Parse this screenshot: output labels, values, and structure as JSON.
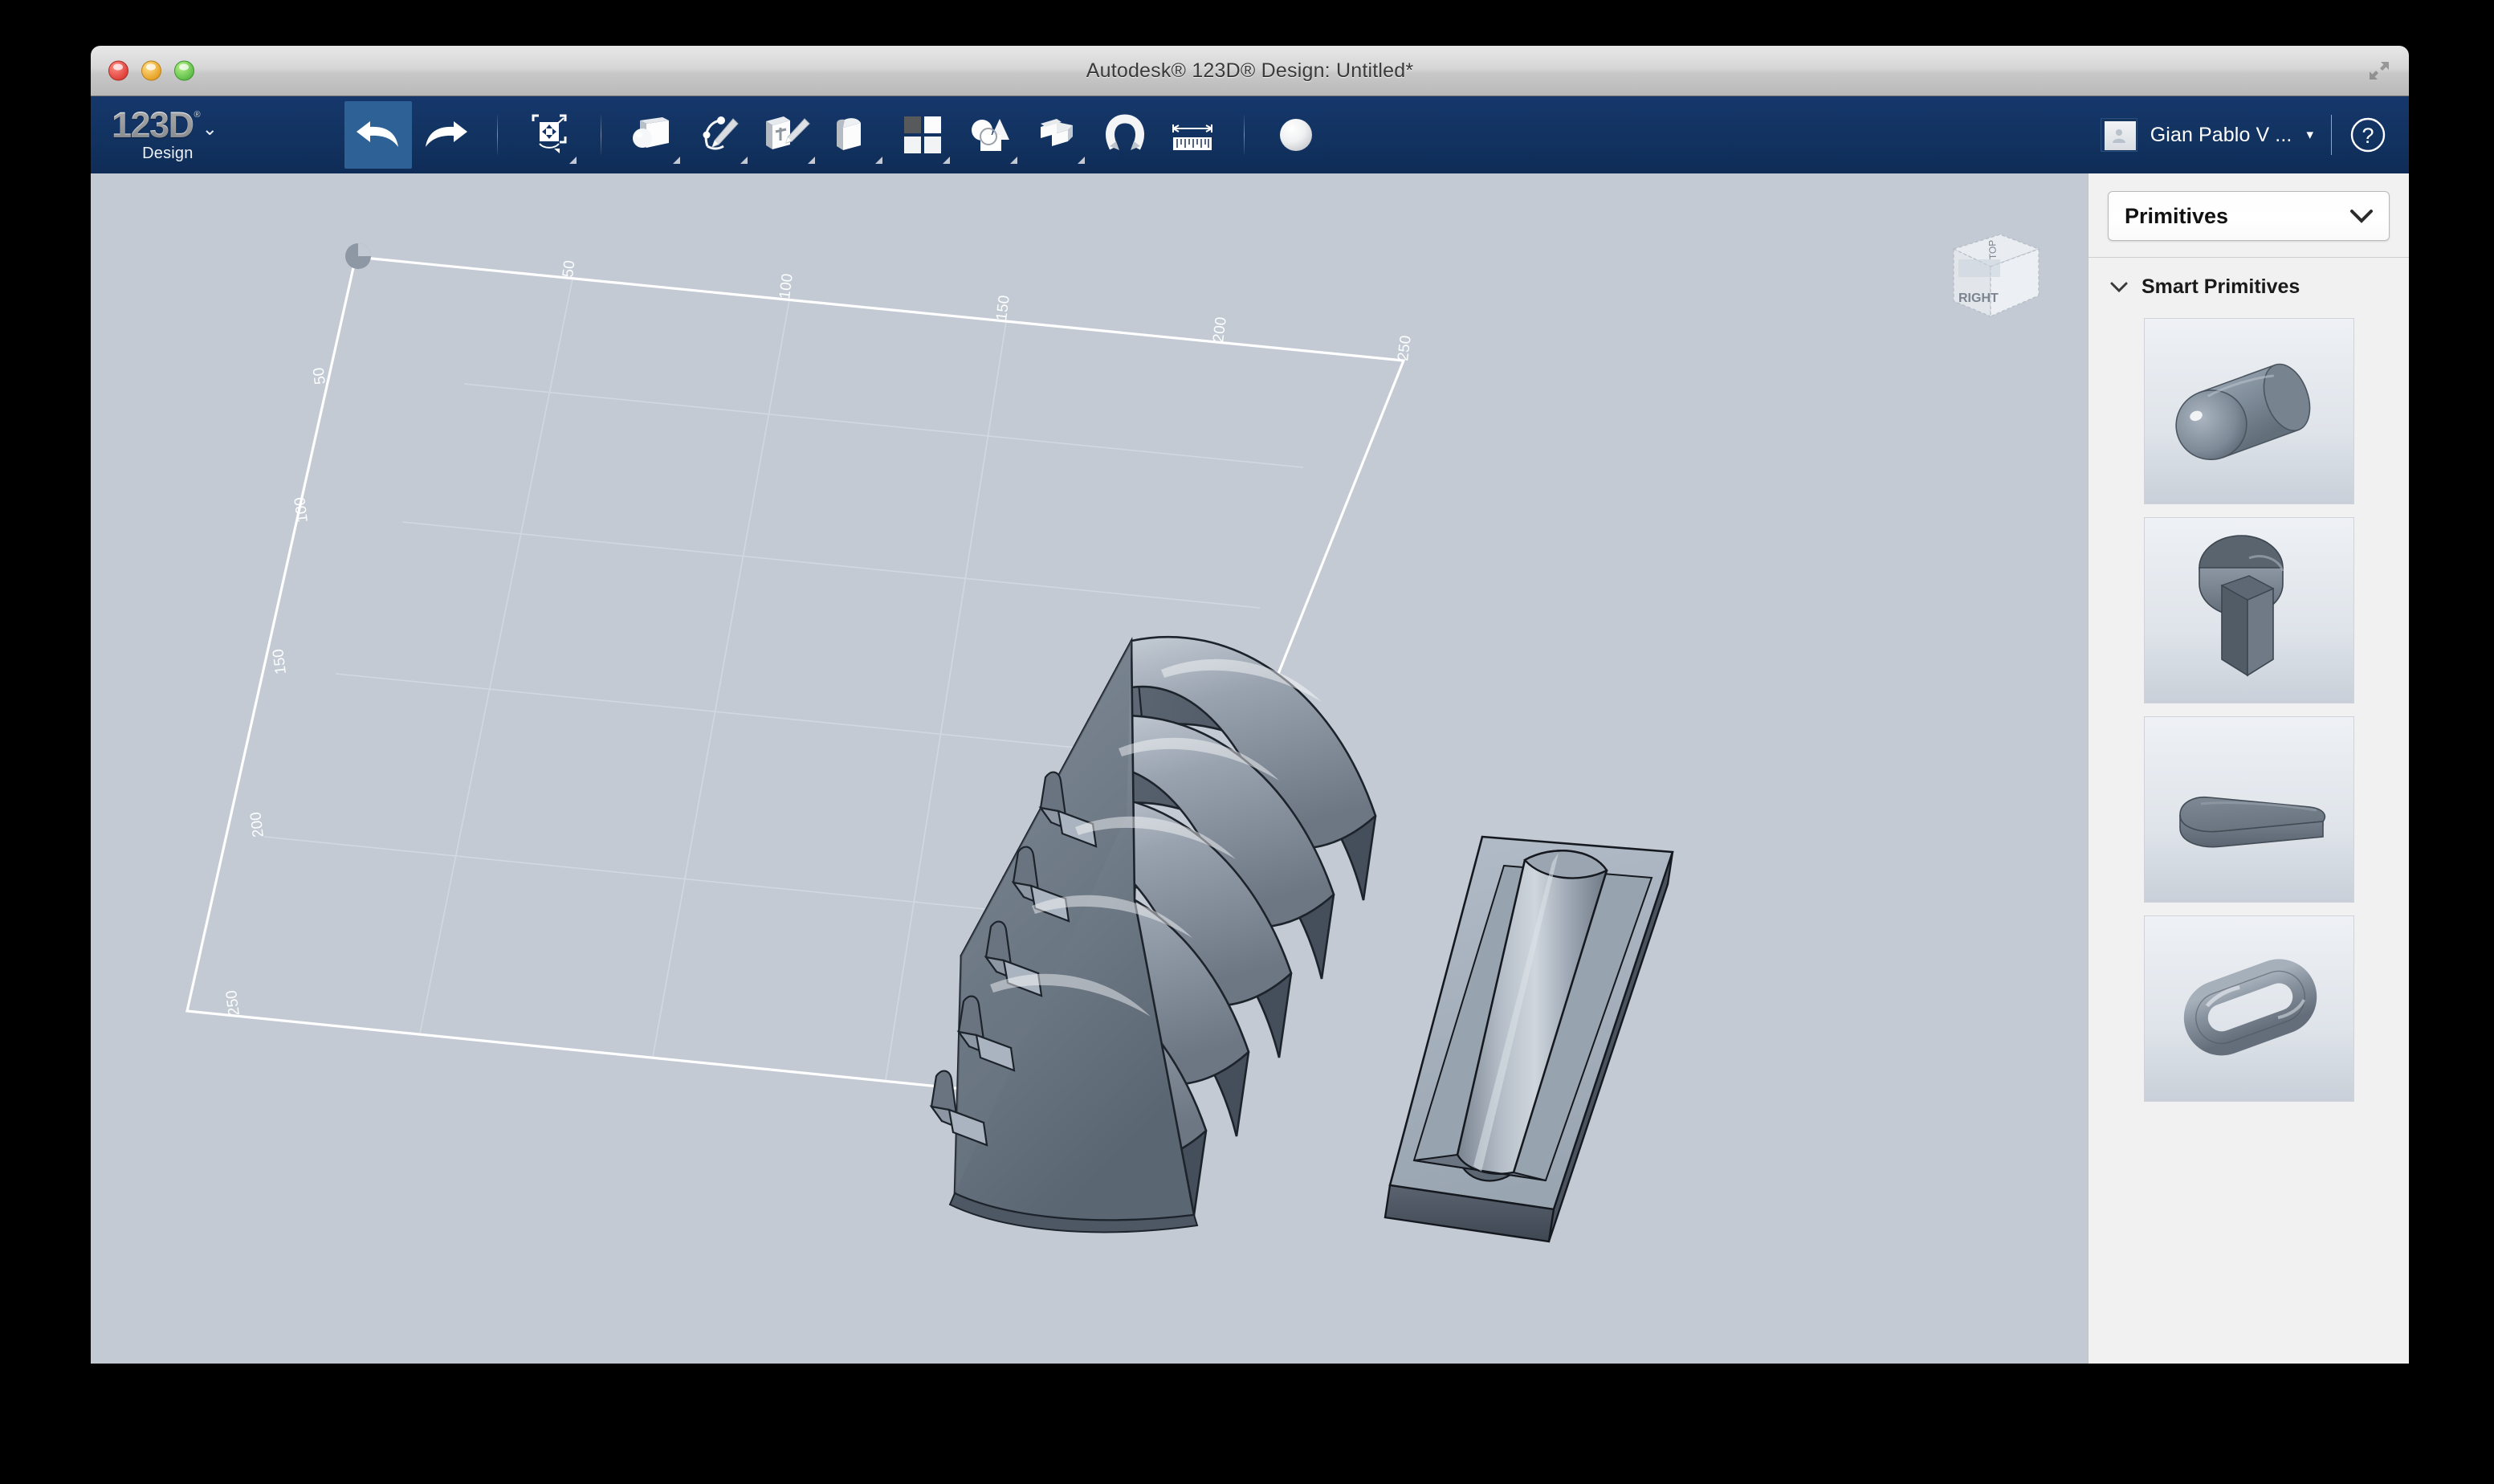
{
  "window": {
    "title": "Autodesk® 123D® Design: Untitled*",
    "controls": {
      "close": "close-button",
      "minimize": "minimize-button",
      "zoom": "zoom-button"
    },
    "fullscreen_label": "Enter Full Screen"
  },
  "brand": {
    "logo_text": "123D",
    "logo_registered": "®",
    "logo_subtitle": "Design",
    "logo_caret": "⌄",
    "accent_color": "#123361",
    "active_button_color": "#2e6297"
  },
  "toolbar": {
    "buttons": [
      {
        "name": "undo",
        "label": "Undo",
        "icon": "undo-arrow-icon",
        "active": true
      },
      {
        "name": "redo",
        "label": "Redo",
        "icon": "redo-arrow-icon",
        "active": false
      },
      {
        "name": "transform",
        "label": "Transform",
        "icon": "transform-move-icon",
        "active": false
      },
      {
        "name": "primitives",
        "label": "Primitives",
        "icon": "primitives-sphere-box-icon",
        "active": false
      },
      {
        "name": "sketch",
        "label": "Sketch",
        "icon": "sketch-pencil-icon",
        "active": false
      },
      {
        "name": "construct",
        "label": "Construct",
        "icon": "construct-cube-pencil-icon",
        "active": false
      },
      {
        "name": "modify",
        "label": "Modify",
        "icon": "modify-rounded-cube-icon",
        "active": false
      },
      {
        "name": "pattern",
        "label": "Pattern",
        "icon": "pattern-grid-icon",
        "active": false
      },
      {
        "name": "grouping",
        "label": "Grouping",
        "icon": "grouping-shapes-icon",
        "active": false
      },
      {
        "name": "combine",
        "label": "Combine",
        "icon": "combine-boolean-icon",
        "active": false
      },
      {
        "name": "snap",
        "label": "Snap",
        "icon": "snap-magnet-icon",
        "active": false
      },
      {
        "name": "measure",
        "label": "Measure",
        "icon": "measure-ruler-icon",
        "active": false
      },
      {
        "name": "material",
        "label": "Material",
        "icon": "material-sphere-icon",
        "active": false
      }
    ]
  },
  "account": {
    "user_name": "Gian Pablo V ...",
    "caret": "▾",
    "avatar_icon": "user-avatar-icon",
    "help_icon": "help-question-icon",
    "help_label": "?"
  },
  "panel": {
    "selected_category": "Primitives",
    "categories": [
      "Primitives"
    ],
    "chevron_down": "⌄",
    "section": {
      "title": "Smart Primitives",
      "expanded": true,
      "items": [
        {
          "name": "capsule",
          "label": "Capsule",
          "icon": "capsule-primitive-icon"
        },
        {
          "name": "keyhole-slot",
          "label": "Keyhole Slot",
          "icon": "keyhole-slot-primitive-icon"
        },
        {
          "name": "rounded-bar",
          "label": "Rounded Bar",
          "icon": "rounded-bar-primitive-icon"
        },
        {
          "name": "stadium-ring",
          "label": "Stadium Ring",
          "icon": "stadium-ring-primitive-icon"
        }
      ]
    }
  },
  "viewport": {
    "background_color": "#c3cad4",
    "grid": {
      "top_axis_labels": [
        "50",
        "100",
        "150",
        "200",
        "250"
      ],
      "left_axis_labels": [
        "50",
        "100",
        "150",
        "200",
        "250"
      ],
      "origin_handle": "grid-origin-handle"
    },
    "viewcube": {
      "top_face_label": "TOP",
      "front_face_label": "",
      "right_face_label": "RIGHT"
    },
    "models": [
      {
        "name": "finned-comb-solid",
        "label": "Finned comb solid",
        "fin_count": 5
      },
      {
        "name": "ridged-plate-solid",
        "label": "Ridged plate solid"
      }
    ]
  }
}
